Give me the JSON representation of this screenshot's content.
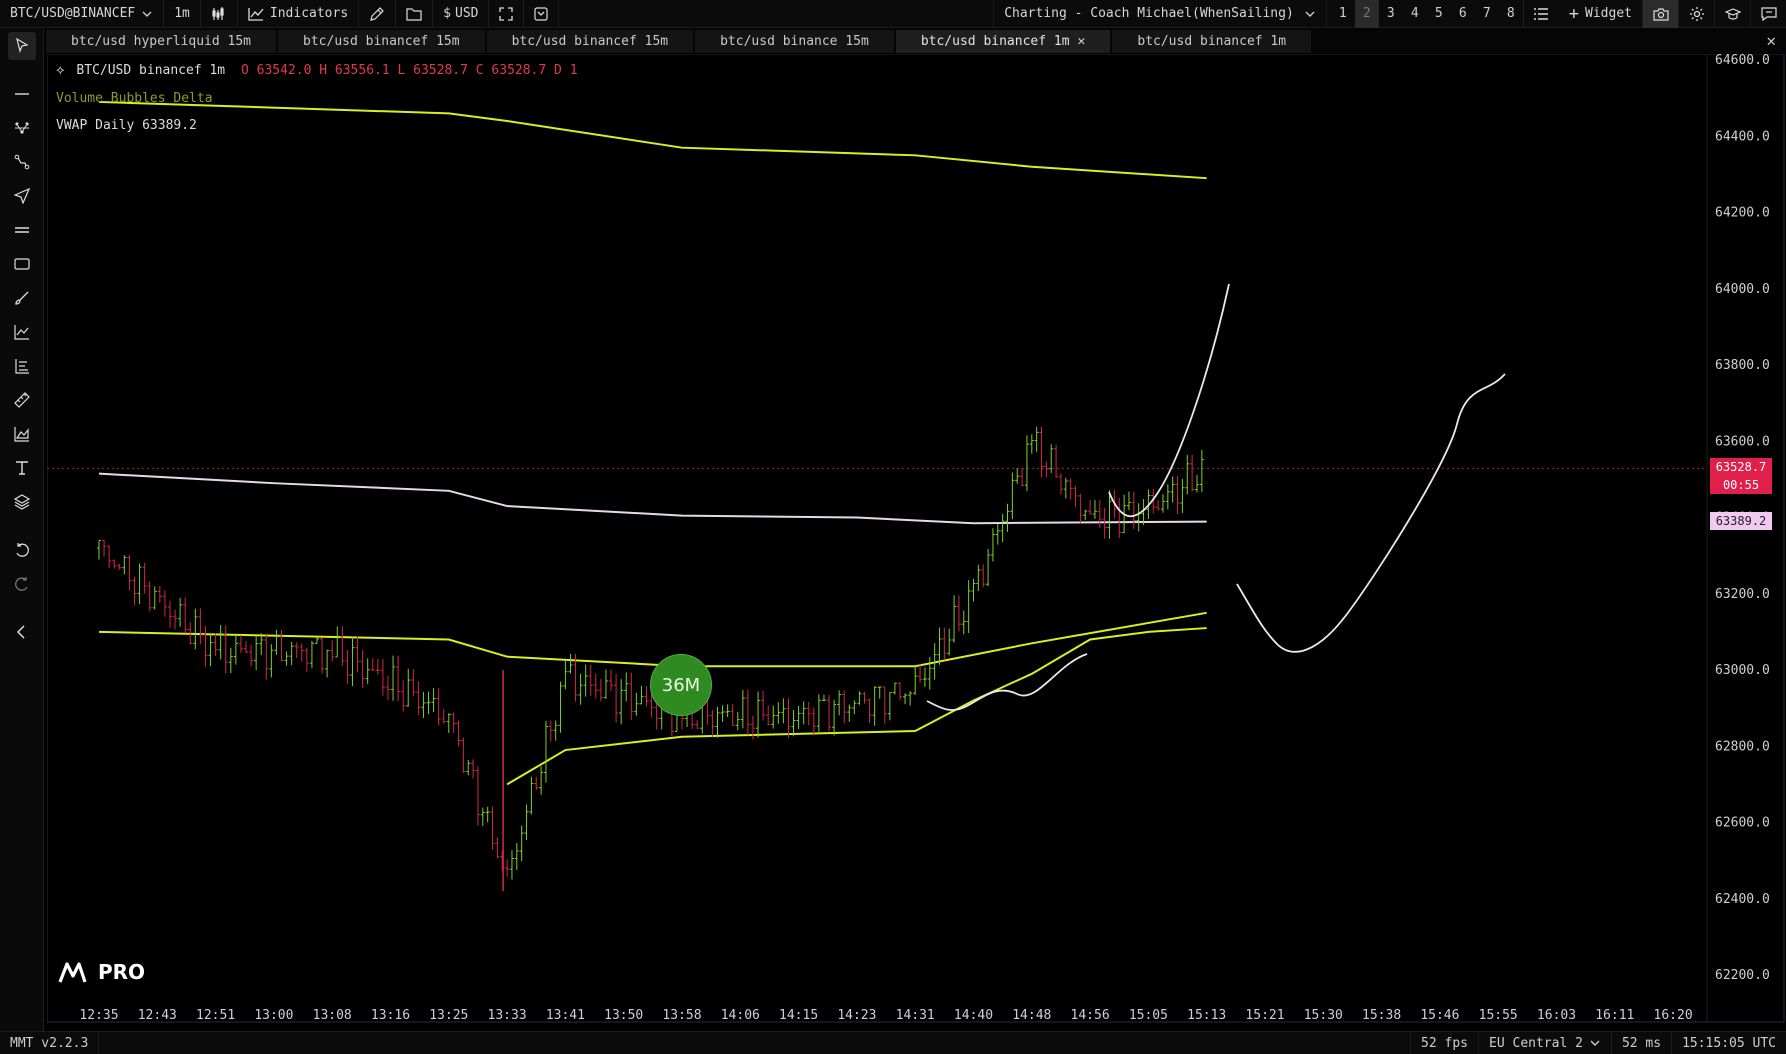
{
  "topbar": {
    "symbol": "BTC/USD@BINANCEF",
    "interval": "1m",
    "indicators_label": "Indicators",
    "currency": "USD",
    "layout_name": "Charting - Coach Michael(WhenSailing)",
    "layout_numbers": [
      "1",
      "2",
      "3",
      "4",
      "5",
      "6",
      "7",
      "8"
    ],
    "active_layout": "2",
    "widget_label": "Widget"
  },
  "tabs": [
    {
      "label": "btc/usd hyperliquid 15m",
      "active": false
    },
    {
      "label": "btc/usd binancef 15m",
      "active": false
    },
    {
      "label": "btc/usd binancef 15m",
      "active": false
    },
    {
      "label": "btc/usd binance 15m",
      "active": false
    },
    {
      "label": "btc/usd binancef 1m",
      "active": true
    },
    {
      "label": "btc/usd binancef 1m",
      "active": false
    }
  ],
  "legend": {
    "title": "BTC/USD binancef 1m",
    "ohlc": "O 63542.0 H 63556.1 L 63528.7 C 63528.7 D 1",
    "indicator1": "Volume Bubbles Delta",
    "indicator2": "VWAP Daily 63389.2"
  },
  "price_axis": [
    "64600.0",
    "64400.0",
    "64200.0",
    "64000.0",
    "63800.0",
    "63600.0",
    "63400.0",
    "63200.0",
    "63000.0",
    "62800.0",
    "62600.0",
    "62400.0",
    "62200.0"
  ],
  "time_axis": [
    "12:35",
    "12:43",
    "12:51",
    "13:00",
    "13:08",
    "13:16",
    "13:25",
    "13:33",
    "13:41",
    "13:50",
    "13:58",
    "14:06",
    "14:15",
    "14:23",
    "14:31",
    "14:40",
    "14:48",
    "14:56",
    "15:05",
    "15:13",
    "15:21",
    "15:30",
    "15:38",
    "15:46",
    "15:55",
    "16:03",
    "16:11",
    "16:20"
  ],
  "last_price": {
    "price": "63528.7",
    "countdown": "00:55",
    "color": "#e0204a"
  },
  "vwap_tag": {
    "price": "63389.2",
    "color": "#f0c8f0"
  },
  "bubble": {
    "label": "36M",
    "color": "#2f8a22"
  },
  "logo": {
    "text": "PRO"
  },
  "colors": {
    "band": "#d8f020",
    "vwap": "#e8d8ec",
    "up": "#7fcf2a",
    "down": "#d02848"
  },
  "status": {
    "version": "MMT v2.2.3",
    "fps": "52 fps",
    "server": "EU Central 2",
    "latency": "52 ms",
    "time": "15:15:05 UTC"
  },
  "chart_data": {
    "type": "candlestick",
    "title": "BTC/USD binancef 1m",
    "ylim": [
      62100,
      64650
    ],
    "y_ticks": [
      64600,
      64400,
      64200,
      64000,
      63800,
      63600,
      63400,
      63200,
      63000,
      62800,
      62600,
      62400,
      62200
    ],
    "last_price": 63528.7,
    "vwap_daily": 63389.2,
    "x_ticks": [
      "12:35",
      "12:43",
      "12:51",
      "13:00",
      "13:08",
      "13:16",
      "13:25",
      "13:33",
      "13:41",
      "13:50",
      "13:58",
      "14:06",
      "14:15",
      "14:23",
      "14:31",
      "14:40",
      "14:48",
      "14:56",
      "15:05",
      "15:13",
      "15:21",
      "15:30",
      "15:38",
      "15:46",
      "15:55",
      "16:03",
      "16:11",
      "16:20"
    ],
    "series": [
      {
        "name": "VWAP Daily",
        "color": "#e8d8ec",
        "points": [
          [
            "12:35",
            63515
          ],
          [
            "13:00",
            63490
          ],
          [
            "13:25",
            63470
          ],
          [
            "13:33",
            63430
          ],
          [
            "13:58",
            63405
          ],
          [
            "14:23",
            63400
          ],
          [
            "14:40",
            63385
          ],
          [
            "15:13",
            63389.2
          ]
        ]
      },
      {
        "x": [
          "12:35",
          "13:25",
          "13:33",
          "13:58",
          "14:31",
          "14:48",
          "15:13"
        ],
        "values": [
          64490,
          64460,
          64440,
          64370,
          64350,
          64320,
          64290
        ]
      },
      {
        "x": [
          "12:35",
          "13:25",
          "13:33",
          "13:58",
          "14:31",
          "14:48",
          "15:13"
        ],
        "values": [
          63100,
          63080,
          63035,
          63010,
          63010,
          63070,
          63150
        ]
      },
      {
        "x": [
          "13:33",
          "13:41",
          "13:58",
          "14:31",
          "14:40",
          "14:48",
          "14:56",
          "15:05",
          "15:13"
        ],
        "values": [
          62700,
          62790,
          62825,
          62840,
          62920,
          62990,
          63080,
          63100,
          63110
        ]
      }
    ],
    "candles_approx": [
      {
        "time": "12:35",
        "close": 63320
      },
      {
        "time": "12:51",
        "close": 63050
      },
      {
        "time": "13:08",
        "close": 63050
      },
      {
        "time": "13:25",
        "close": 62880
      },
      {
        "time": "13:33",
        "close": 62450
      },
      {
        "time": "13:41",
        "close": 62980
      },
      {
        "time": "13:58",
        "close": 62880
      },
      {
        "time": "14:15",
        "close": 62880
      },
      {
        "time": "14:31",
        "close": 62950
      },
      {
        "time": "14:40",
        "close": 63200
      },
      {
        "time": "14:48",
        "close": 63600
      },
      {
        "time": "14:56",
        "close": 63400
      },
      {
        "time": "15:05",
        "close": 63420
      },
      {
        "time": "15:13",
        "close": 63528.7
      }
    ]
  }
}
